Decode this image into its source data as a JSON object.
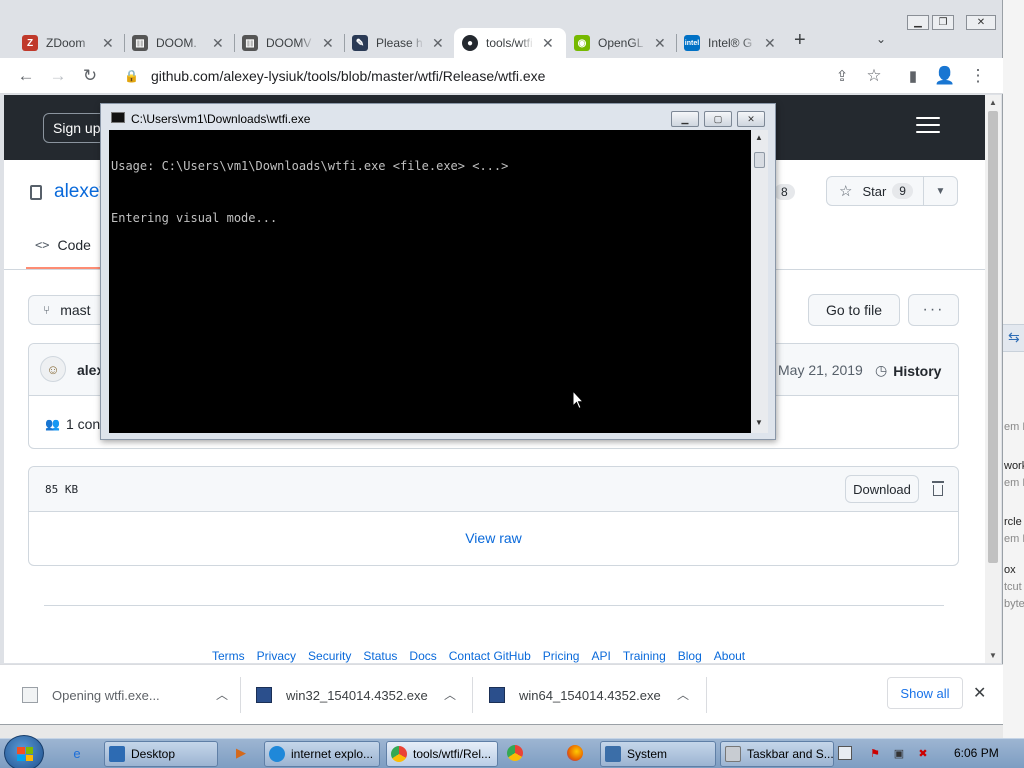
{
  "browser": {
    "tabs": [
      {
        "title": "ZDoom",
        "favicon_color": "#c0392b"
      },
      {
        "title": "DOOM.",
        "favicon_color": "#555555"
      },
      {
        "title": "DOOMV",
        "favicon_color": "#555555"
      },
      {
        "title": "Please h",
        "favicon_color": "#2a3a55"
      },
      {
        "title": "tools/wtfi",
        "favicon_color": "#24292f",
        "active": true
      },
      {
        "title": "OpenGL",
        "favicon_color": "#76b900"
      },
      {
        "title": "Intel® G",
        "favicon_color": "#0071c5"
      }
    ],
    "tab_icons": [
      "zdoom-icon",
      "doom-wiki-icon",
      "doom-wiki-icon",
      "puzzle-icon",
      "github-icon",
      "nvidia-icon",
      "intel-icon"
    ],
    "url_host": "github.com",
    "url_path": "/alexey-lysiuk/tools/blob/master/wtfi/Release/wtfi.exe"
  },
  "github": {
    "signup_label": "Sign up",
    "repo_owner": "alexey",
    "forks": "8",
    "star_label": "Star",
    "stars": "9",
    "code_tab_label": "Code",
    "branch_label": "mast",
    "goto_file_label": "Go to file",
    "more_label": "···",
    "commit_author": "alex",
    "commit_date": "May 21, 2019",
    "history_label": "History",
    "contributors_label": "1 con",
    "file_size": "85 KB",
    "download_label": "Download",
    "view_raw_label": "View raw",
    "footer_links": [
      "Terms",
      "Privacy",
      "Security",
      "Status",
      "Docs",
      "Contact GitHub",
      "Pricing",
      "API",
      "Training",
      "Blog",
      "About"
    ]
  },
  "console": {
    "title": "C:\\Users\\vm1\\Downloads\\wtfi.exe",
    "lines": [
      "Usage: C:\\Users\\vm1\\Downloads\\wtfi.exe <file.exe> <...>",
      "Entering visual mode..."
    ]
  },
  "downloads": {
    "items": [
      {
        "label": "Opening wtfi.exe...",
        "status": "opening"
      },
      {
        "label": "win32_154014.4352.exe",
        "status": "complete"
      },
      {
        "label": "win64_154014.4352.exe",
        "status": "complete"
      }
    ],
    "show_all_label": "Show all"
  },
  "background_window": {
    "text_fragments": [
      "em F",
      "work",
      "em F",
      "rcle",
      "em F",
      "ox",
      "tcut",
      "byte"
    ]
  },
  "taskbar": {
    "tasks": [
      {
        "label": "Desktop",
        "icon": "desktop-icon"
      },
      {
        "label": "internet explo...",
        "icon": "edge-icon"
      },
      {
        "label": "tools/wtfi/Rel...",
        "icon": "chrome-icon"
      },
      {
        "label": "System",
        "icon": "system-icon"
      },
      {
        "label": "Taskbar and S...",
        "icon": "taskbar-settings-icon"
      }
    ],
    "clock": "6:06 PM"
  },
  "colors": {
    "github_header": "#24292f",
    "link_blue": "#0969da",
    "console_bg": "#000000",
    "console_fg": "#c0c0c0",
    "taskbar": "#9db5d2"
  }
}
